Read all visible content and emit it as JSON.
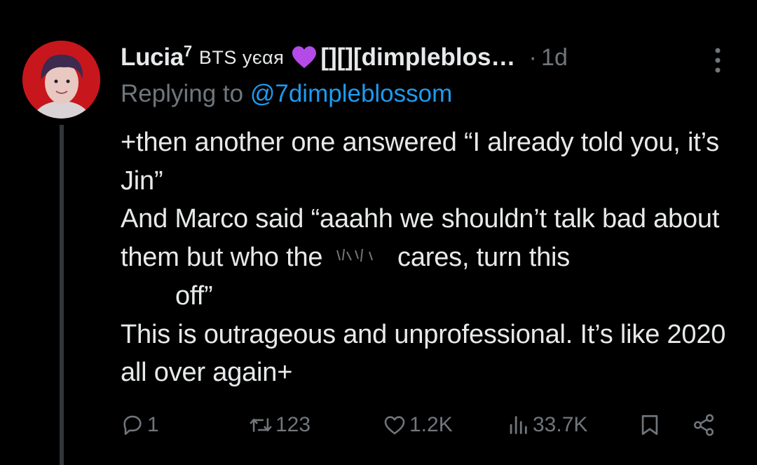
{
  "tweet": {
    "author_name": "Lucia",
    "author_sup": "7",
    "author_tag": "BTS уєαя",
    "author_handle": "[][][dimpleblosso...",
    "time": "1d",
    "replying_prefix": "Replying to",
    "replying_to": "@7dimpleblossom",
    "lines": {
      "p1": "+then another one answered “I already told you, it’s Jin”",
      "p2a": "And Marco said “aaahh we shouldn’t talk bad about them but who the",
      "p2b": "cares, turn this",
      "p2c": "off”",
      "p3": "This is outrageous and unprofessional. It’s like 2020 all over again+"
    }
  },
  "actions": {
    "replies": "1",
    "retweets": "123",
    "likes": "1.2K",
    "views": "33.7K"
  },
  "colors": {
    "background": "#000000",
    "text": "#e7e9ea",
    "muted": "#71767b",
    "link": "#1d9bf0",
    "heart": "#b44ae8",
    "avatar_bg": "#c8161d"
  },
  "icons": [
    "purple-heart-icon",
    "more-icon",
    "reply-icon",
    "retweet-icon",
    "like-icon",
    "views-icon",
    "bookmark-icon",
    "share-icon"
  ]
}
